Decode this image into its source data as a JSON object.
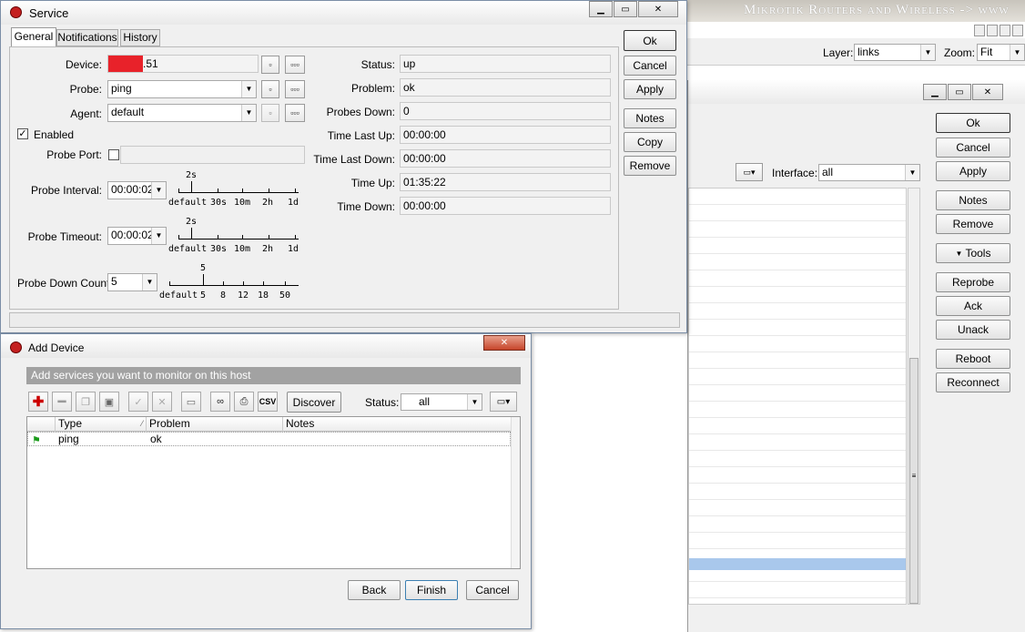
{
  "background": {
    "banner": "Mikrotik Routers and Wireless -> www",
    "layer_label": "Layer:",
    "layer_value": "links",
    "zoom_label": "Zoom:",
    "zoom_value": "Fit"
  },
  "device_window": {
    "buttons": [
      "Ok",
      "Cancel",
      "Apply",
      "Notes",
      "Remove",
      "Tools",
      "Reprobe",
      "Ack",
      "Unack",
      "Reboot",
      "Reconnect"
    ],
    "interface_label": "Interface:",
    "interface_value": "all"
  },
  "service": {
    "title": "Service",
    "tabs": [
      "General",
      "Notifications",
      "History"
    ],
    "device_label": "Device:",
    "device_value": ".51",
    "probe_label": "Probe:",
    "probe_value": "ping",
    "agent_label": "Agent:",
    "agent_value": "default",
    "enabled_label": "Enabled",
    "probe_port_label": "Probe Port:",
    "probe_interval_label": "Probe Interval:",
    "probe_interval_value": "00:00:02",
    "probe_interval_marker": "2s",
    "probe_timeout_label": "Probe Timeout:",
    "probe_timeout_value": "00:00:02",
    "probe_timeout_marker": "2s",
    "time_ticks": [
      "default",
      "30s",
      "10m",
      "2h",
      "1d"
    ],
    "probe_down_count_label": "Probe Down Count:",
    "probe_down_count_value": "5",
    "probe_down_count_marker": "5",
    "count_ticks": [
      "default",
      "5",
      "8",
      "12",
      "18",
      "50"
    ],
    "status_rows": [
      {
        "label": "Status:",
        "value": "up"
      },
      {
        "label": "Problem:",
        "value": "ok"
      },
      {
        "label": "Probes Down:",
        "value": "0"
      },
      {
        "label": "Time Last Up:",
        "value": "00:00:00"
      },
      {
        "label": "Time Last Down:",
        "value": "00:00:00"
      },
      {
        "label": "Time Up:",
        "value": "01:35:22"
      },
      {
        "label": "Time Down:",
        "value": "00:00:00"
      }
    ],
    "buttons": [
      "Ok",
      "Cancel",
      "Apply",
      "Notes",
      "Copy",
      "Remove"
    ]
  },
  "add_device": {
    "title": "Add Device",
    "header": "Add services you want to monitor on this host",
    "discover_label": "Discover",
    "status_label": "Status:",
    "status_value": "all",
    "columns": [
      "Type",
      "Problem",
      "Notes"
    ],
    "rows": [
      {
        "type": "ping",
        "problem": "ok",
        "notes": ""
      }
    ],
    "back_label": "Back",
    "finish_label": "Finish",
    "cancel_label": "Cancel"
  }
}
